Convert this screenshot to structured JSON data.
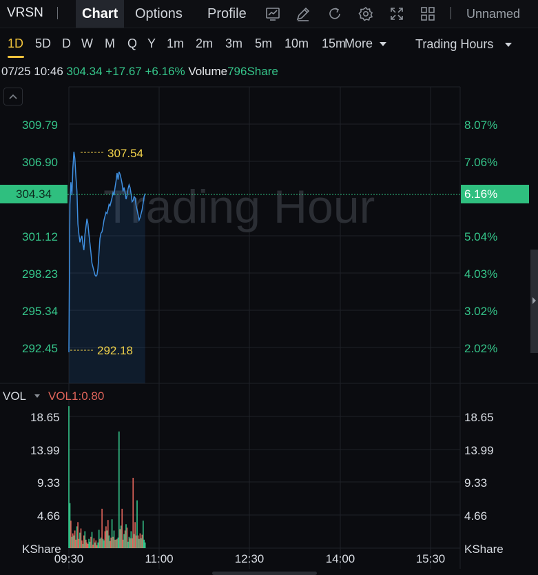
{
  "toolbar": {
    "ticker": "VRSN",
    "tabs": [
      {
        "label": "Chart",
        "active": true
      },
      {
        "label": "Options",
        "active": false
      },
      {
        "label": "Profile",
        "active": false
      }
    ],
    "icons": [
      "chart-style-icon",
      "drawing-pen-icon",
      "refresh-icon",
      "settings-gear-icon",
      "fullscreen-icon",
      "layout-grid-icon"
    ],
    "layout_name": "Unnamed"
  },
  "periods": {
    "items": [
      "1D",
      "5D",
      "D",
      "W",
      "M",
      "Q",
      "Y",
      "1m",
      "2m",
      "3m",
      "5m",
      "10m",
      "15m"
    ],
    "active": "1D",
    "more_label": "More",
    "session_label": "Trading Hours"
  },
  "quote": {
    "time": "07/25 10:46",
    "price": "304.34",
    "change": "+17.67",
    "change_pct": "+6.16%",
    "volume_label": "Volume",
    "volume_value": "796Share"
  },
  "price_axis": {
    "left_ticks": [
      "309.79",
      "306.90",
      "301.12",
      "298.23",
      "295.34",
      "292.45"
    ],
    "right_ticks": [
      "8.07%",
      "7.06%",
      "5.04%",
      "4.03%",
      "3.02%",
      "2.02%"
    ],
    "current_price": "304.34",
    "current_pct": "6.16%",
    "high_marker": "307.54",
    "low_marker": "292.18"
  },
  "watermark": "Trading Hour",
  "volume_panel": {
    "title": "VOL",
    "param": "VOL1:0.80",
    "ticks": [
      "18.65",
      "13.99",
      "9.33",
      "4.66"
    ],
    "unit": "KShare"
  },
  "time_axis": [
    "09:30",
    "11:00",
    "12:30",
    "14:00",
    "15:30"
  ],
  "colors": {
    "up": "#35c58a",
    "down": "#e0645a",
    "line": "#3f8fe0",
    "accent": "#f0c33c"
  },
  "chart_data": {
    "type": "line",
    "title": "",
    "xlabel": "",
    "ylabel": "",
    "ylim": [
      289.8,
      312.5
    ],
    "x": [
      "09:30",
      "09:31",
      "09:32",
      "09:33",
      "09:34",
      "09:35",
      "09:36",
      "09:37",
      "09:38",
      "09:39",
      "09:40",
      "09:41",
      "09:42",
      "09:43",
      "09:44",
      "09:45",
      "09:46",
      "09:47",
      "09:48",
      "09:49",
      "09:50",
      "09:51",
      "09:52",
      "09:53",
      "09:54",
      "09:55",
      "09:56",
      "09:57",
      "09:58",
      "09:59",
      "10:00",
      "10:01",
      "10:02",
      "10:03",
      "10:04",
      "10:05",
      "10:06",
      "10:07",
      "10:08",
      "10:09",
      "10:10",
      "10:11",
      "10:12",
      "10:13",
      "10:14",
      "10:15",
      "10:16",
      "10:17",
      "10:18",
      "10:19",
      "10:20",
      "10:21",
      "10:22",
      "10:23",
      "10:24",
      "10:25",
      "10:26",
      "10:27",
      "10:28",
      "10:29",
      "10:30",
      "10:31",
      "10:32",
      "10:33",
      "10:34",
      "10:35",
      "10:36",
      "10:37",
      "10:38",
      "10:39",
      "10:40",
      "10:41",
      "10:42",
      "10:43",
      "10:44",
      "10:45",
      "10:46"
    ],
    "series": [
      {
        "values": [
          292.18,
          303.5,
          305.2,
          304.2,
          306.3,
          307.54,
          307.0,
          305.6,
          304.5,
          302.0,
          301.2,
          300.6,
          300.9,
          301.1,
          300.4,
          300.0,
          301.2,
          301.8,
          302.4,
          302.0,
          301.2,
          300.5,
          299.8,
          299.0,
          298.7,
          298.4,
          298.1,
          298.0,
          298.1,
          298.6,
          299.8,
          300.9,
          301.3,
          301.4,
          301.8,
          302.3,
          302.6,
          302.9,
          302.8,
          303.1,
          303.5,
          303.4,
          303.7,
          304.0,
          304.4,
          304.2,
          304.8,
          305.3,
          305.9,
          305.4,
          306.0,
          305.8,
          305.5,
          305.1,
          304.5,
          304.8,
          304.4,
          303.9,
          304.2,
          304.7,
          305.0,
          304.8,
          304.3,
          303.7,
          303.8,
          304.1,
          304.0,
          303.4,
          303.1,
          302.7,
          302.3,
          302.5,
          302.8,
          303.1,
          303.6,
          304.1,
          304.34
        ]
      }
    ],
    "volume": {
      "unit": "KShare",
      "ylim": [
        0,
        20.5
      ],
      "values": [
        20.2,
        6.4,
        3.9,
        1.6,
        2.1,
        1.8,
        2.5,
        1.2,
        3.1,
        3.7,
        1.3,
        2.2,
        2.8,
        1.1,
        0.6,
        1.8,
        2.4,
        1.2,
        0.8,
        0.6,
        1.3,
        0.9,
        1.6,
        2.3,
        0.5,
        1.4,
        0.8,
        1.1,
        0.4,
        0.8,
        2.6,
        1.3,
        1.5,
        5.6,
        1.3,
        1.1,
        2.4,
        3.1,
        2.5,
        4.0,
        1.8,
        1.0,
        1.5,
        4.1,
        1.6,
        2.5,
        1.2,
        1.2,
        1.3,
        1.5,
        16.6,
        2.7,
        3.2,
        5.6,
        1.2,
        2.0,
        2.5,
        3.4,
        2.9,
        0.9,
        1.6,
        1.4,
        2.4,
        1.4,
        10.0,
        2.0,
        3.7,
        1.8,
        6.8,
        1.8,
        1.3,
        2.1,
        1.4,
        1.9,
        3.9,
        1.2,
        0.8
      ],
      "up": [
        true,
        true,
        false,
        true,
        false,
        true,
        false,
        false,
        true,
        false,
        false,
        true,
        false,
        false,
        true,
        false,
        true,
        false,
        false,
        false,
        true,
        true,
        false,
        true,
        false,
        false,
        true,
        false,
        false,
        true,
        true,
        false,
        true,
        false,
        true,
        true,
        false,
        false,
        true,
        false,
        true,
        false,
        false,
        true,
        false,
        true,
        false,
        true,
        false,
        true,
        true,
        false,
        true,
        false,
        false,
        true,
        false,
        true,
        false,
        true,
        true,
        false,
        true,
        false,
        false,
        true,
        false,
        false,
        true,
        false,
        true,
        false,
        true,
        false,
        true,
        true,
        true
      ]
    }
  }
}
